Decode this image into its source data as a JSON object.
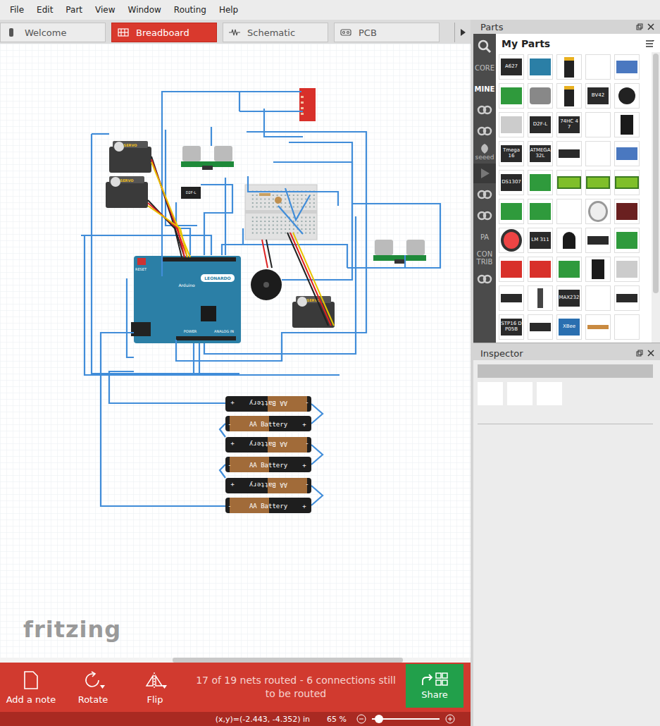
{
  "menu": [
    "File",
    "Edit",
    "Part",
    "View",
    "Window",
    "Routing",
    "Help"
  ],
  "tabs": [
    {
      "label": "Welcome",
      "selected": false,
      "kind": "welcome"
    },
    {
      "label": "Breadboard",
      "selected": true,
      "kind": "breadboard"
    },
    {
      "label": "Schematic",
      "selected": false,
      "kind": "schematic"
    },
    {
      "label": "PCB",
      "selected": false,
      "kind": "pcb"
    }
  ],
  "canvas": {
    "watermark": "fritzing",
    "board": {
      "label": "LEONARDO",
      "brand": "Arduino",
      "reset": "RESET",
      "power": "POWER",
      "analog": "ANALOG IN"
    },
    "servos": [
      {
        "label": "SERVO"
      },
      {
        "label": "SERVO"
      },
      {
        "label": "SERVO"
      }
    ],
    "switch": {
      "label": "D2F-L"
    },
    "batteries": [
      {
        "label": "AA Battery",
        "minus": "-",
        "plus": "+",
        "flipped": true
      },
      {
        "label": "AA Battery",
        "minus": "-",
        "plus": "+",
        "flipped": false
      },
      {
        "label": "AA Battery",
        "minus": "-",
        "plus": "+",
        "flipped": true
      },
      {
        "label": "AA Battery",
        "minus": "-",
        "plus": "+",
        "flipped": false
      },
      {
        "label": "AA Battery",
        "minus": "-",
        "plus": "+",
        "flipped": true
      },
      {
        "label": "AA Battery",
        "minus": "-",
        "plus": "+",
        "flipped": false
      }
    ]
  },
  "toolbar": {
    "buttons": [
      {
        "label": "Add a note",
        "kind": "note",
        "menu": false
      },
      {
        "label": "Rotate",
        "kind": "rotate",
        "menu": true
      },
      {
        "label": "Flip",
        "kind": "flip",
        "menu": true
      }
    ],
    "status": "17 of 19 nets routed - 6 connections still to be routed",
    "share": "Share"
  },
  "status_bar": {
    "coords": "(x,y)=(-2.443, -4.352) in",
    "zoom": "65 %",
    "zoom_level": 0.05
  },
  "parts": {
    "title": "Parts",
    "bin_title": "My Parts",
    "bins": [
      {
        "kind": "search",
        "selected": false
      },
      {
        "kind": "text",
        "label": "CORE",
        "selected": false
      },
      {
        "kind": "text",
        "label": "MINE",
        "selected": true
      },
      {
        "kind": "icon",
        "selected": false
      },
      {
        "kind": "icon",
        "selected": false
      },
      {
        "kind": "seeed",
        "label": "seeed",
        "selected": false
      },
      {
        "kind": "play",
        "selected": false
      },
      {
        "kind": "icon",
        "selected": false
      },
      {
        "kind": "icon",
        "selected": false
      },
      {
        "kind": "text",
        "label": "PA",
        "selected": false
      },
      {
        "kind": "text",
        "label": "CON TRIB",
        "selected": false
      },
      {
        "kind": "icon",
        "selected": false
      }
    ],
    "tiles": [
      {
        "kind": "chip",
        "label": "A627"
      },
      {
        "kind": "arduino"
      },
      {
        "kind": "battery"
      },
      {
        "kind": "blank"
      },
      {
        "kind": "serial"
      },
      {
        "kind": "board"
      },
      {
        "kind": "sensor"
      },
      {
        "kind": "battery"
      },
      {
        "kind": "chip",
        "label": "BV42"
      },
      {
        "kind": "round"
      },
      {
        "kind": "module"
      },
      {
        "kind": "chip",
        "label": "D2F-L"
      },
      {
        "kind": "chip",
        "label": "74HC 47"
      },
      {
        "kind": "blank"
      },
      {
        "kind": "relay"
      },
      {
        "kind": "chip",
        "label": "Tmega 16"
      },
      {
        "kind": "chip",
        "label": "ATMEGA 32L"
      },
      {
        "kind": "dip"
      },
      {
        "kind": "blank"
      },
      {
        "kind": "serial"
      },
      {
        "kind": "chip",
        "label": "DS1307"
      },
      {
        "kind": "board"
      },
      {
        "kind": "lcd"
      },
      {
        "kind": "lcd"
      },
      {
        "kind": "lcd"
      },
      {
        "kind": "board"
      },
      {
        "kind": "board"
      },
      {
        "kind": "blank"
      },
      {
        "kind": "led"
      },
      {
        "kind": "matrix"
      },
      {
        "kind": "button"
      },
      {
        "kind": "chip",
        "label": "LM 311"
      },
      {
        "kind": "transistor"
      },
      {
        "kind": "dip"
      },
      {
        "kind": "board"
      },
      {
        "kind": "red"
      },
      {
        "kind": "red"
      },
      {
        "kind": "board"
      },
      {
        "kind": "relay"
      },
      {
        "kind": "module"
      },
      {
        "kind": "dip"
      },
      {
        "kind": "pot"
      },
      {
        "kind": "chip",
        "label": "MAX232"
      },
      {
        "kind": "blank"
      },
      {
        "kind": "dip"
      },
      {
        "kind": "chip",
        "label": "STP16 DP05B"
      },
      {
        "kind": "dip"
      },
      {
        "kind": "xbee",
        "label": "XBee"
      },
      {
        "kind": "resistor"
      },
      {
        "kind": "blank"
      }
    ]
  },
  "inspector": {
    "title": "Inspector"
  }
}
